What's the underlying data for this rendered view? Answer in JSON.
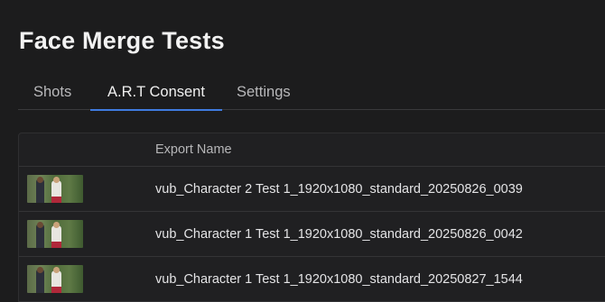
{
  "page": {
    "title": "Face Merge Tests"
  },
  "tabs": [
    {
      "label": "Shots"
    },
    {
      "label": "A.R.T Consent"
    },
    {
      "label": "Settings"
    }
  ],
  "active_tab": "A.R.T Consent",
  "table": {
    "columns": [
      "",
      "Export Name"
    ],
    "rows": [
      {
        "export_name": "vub_Character 2 Test 1_1920x1080_standard_20250826_0039"
      },
      {
        "export_name": "vub_Character 1 Test 1_1920x1080_standard_20250826_0042"
      },
      {
        "export_name": "vub_Character 1 Test 1_1920x1080_standard_20250827_1544"
      }
    ]
  },
  "colors": {
    "background": "#1c1c1d",
    "accent": "#3f7be0",
    "table_bg": "#202022"
  }
}
